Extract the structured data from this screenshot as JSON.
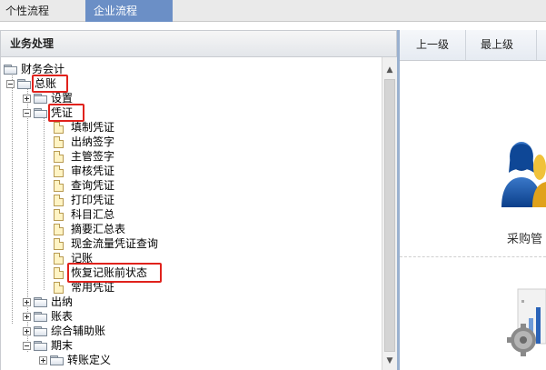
{
  "tabs": [
    {
      "label": "个性流程",
      "active": false
    },
    {
      "label": "企业流程",
      "active": true
    }
  ],
  "panel": {
    "title": "业务处理"
  },
  "tree": {
    "root": "财务会计",
    "zongzhang": "总账",
    "shezhi": "设置",
    "pingzheng": "凭证",
    "pingzheng_items": [
      "填制凭证",
      "出纳签字",
      "主管签字",
      "审核凭证",
      "查询凭证",
      "打印凭证",
      "科目汇总",
      "摘要汇总表",
      "现金流量凭证查询",
      "记账",
      "恢复记账前状态",
      "常用凭证"
    ],
    "chuna": "出纳",
    "zhangbiao": "账表",
    "zonghe": "综合辅助账",
    "qimo": "期末",
    "zhuanzhang": "转账定义"
  },
  "toolbar": {
    "up": "上一级",
    "top": "最上级"
  },
  "right": {
    "caption": "采购管"
  },
  "colors": {
    "accent": "#6b8fc6",
    "highlight": "#e0221c",
    "splitter": "#9ab1cf"
  }
}
